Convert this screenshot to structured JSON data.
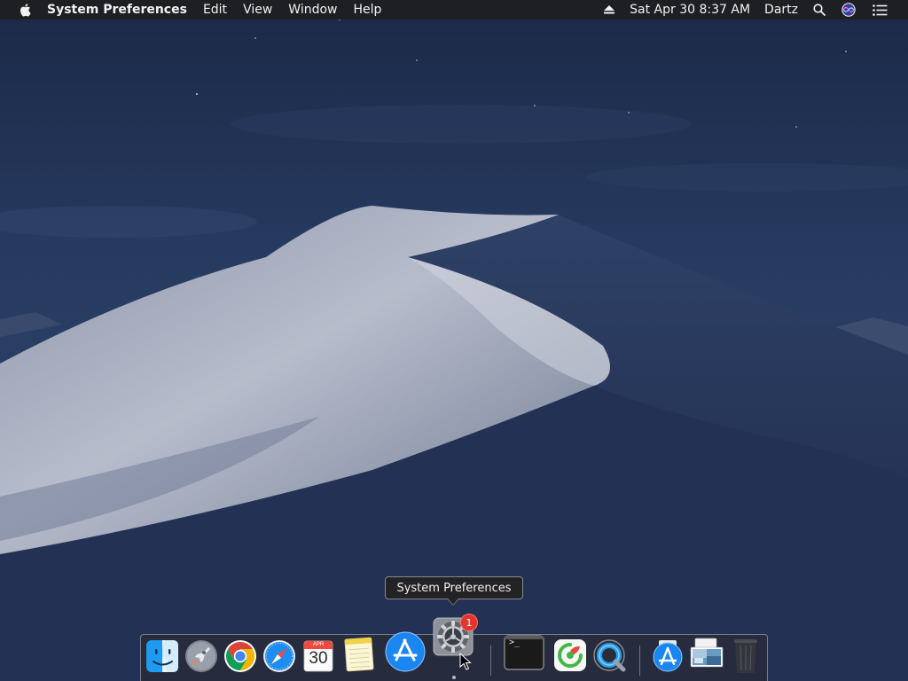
{
  "menubar": {
    "apple_icon": "apple-logo-icon",
    "app_name": "System Preferences",
    "menus": [
      "Edit",
      "View",
      "Window",
      "Help"
    ],
    "status": {
      "eject_icon": "eject-icon",
      "clock": "Sat Apr 30  8:37 AM",
      "user": "Dartz",
      "search_icon": "spotlight-search-icon",
      "siri_icon": "siri-icon",
      "notifications_icon": "notification-center-icon"
    }
  },
  "tooltip": {
    "text": "System Preferences"
  },
  "dock": {
    "items": [
      {
        "name": "Finder",
        "icon": "finder-icon"
      },
      {
        "name": "Launchpad",
        "icon": "launchpad-icon"
      },
      {
        "name": "Google Chrome",
        "icon": "chrome-icon"
      },
      {
        "name": "Safari",
        "icon": "safari-icon"
      },
      {
        "name": "Calendar",
        "icon": "calendar-icon",
        "month": "APR",
        "day": "30"
      },
      {
        "name": "Notes",
        "icon": "notes-icon"
      },
      {
        "name": "App Store",
        "icon": "app-store-icon"
      },
      {
        "name": "System Preferences",
        "icon": "system-preferences-icon",
        "badge": "1"
      },
      {
        "name": "Terminal",
        "icon": "terminal-icon",
        "prompt": ">_"
      },
      {
        "name": "Tool",
        "icon": "green-app-icon"
      },
      {
        "name": "QuickTime Player",
        "icon": "quicktime-icon"
      },
      {
        "name": "Downloads",
        "icon": "downloads-stack-icon"
      },
      {
        "name": "Documents",
        "icon": "documents-stack-icon"
      },
      {
        "name": "Trash",
        "icon": "trash-icon"
      }
    ]
  },
  "colors": {
    "menubar_bg": "#1e1e20",
    "badge": "#e5342c",
    "tooltip_bg": "#232325"
  }
}
